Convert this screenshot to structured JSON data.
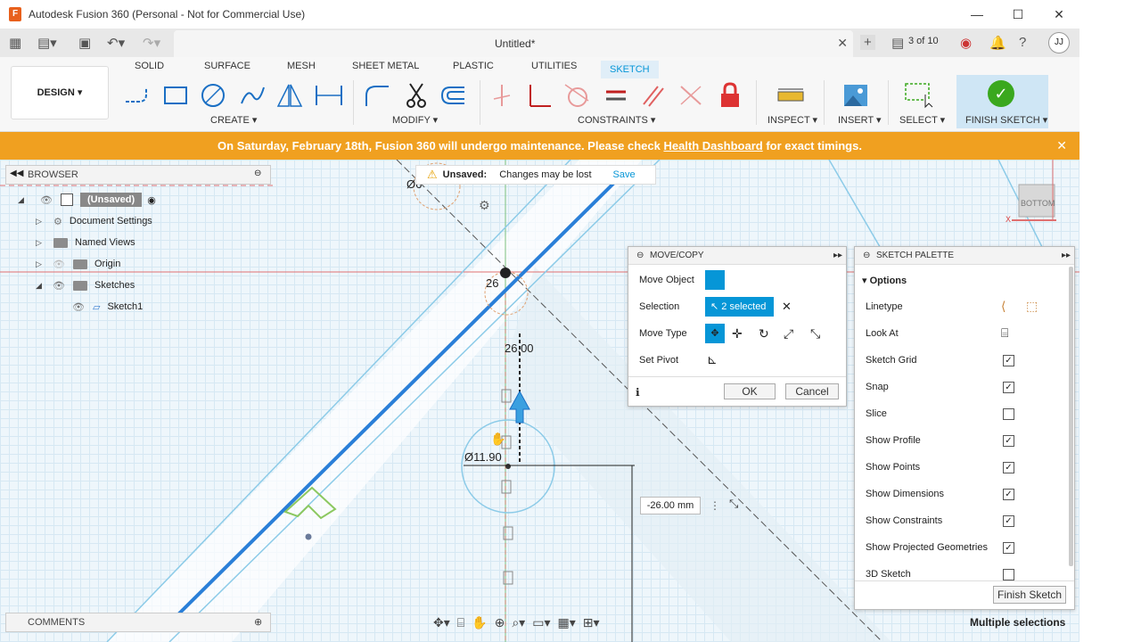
{
  "window": {
    "title": "Autodesk Fusion 360 (Personal - Not for Commercial Use)",
    "minimize": "—",
    "maximize": "☐",
    "close": "✕"
  },
  "tabbar": {
    "doc_title": "Untitled*",
    "count": "3 of 10",
    "user_initials": "JJ"
  },
  "ribbon": {
    "workspace": "DESIGN ▾",
    "tabs": [
      "SOLID",
      "SURFACE",
      "MESH",
      "SHEET METAL",
      "PLASTIC",
      "UTILITIES",
      "SKETCH"
    ],
    "groups": {
      "create": "CREATE ▾",
      "modify": "MODIFY ▾",
      "constraints": "CONSTRAINTS ▾",
      "inspect": "INSPECT ▾",
      "insert": "INSERT ▾",
      "select": "SELECT ▾",
      "finish": "FINISH SKETCH ▾"
    }
  },
  "banner": {
    "text_before": "On Saturday, February 18th, Fusion 360 will undergo maintenance. Please check ",
    "link": "Health Dashboard",
    "text_after": " for exact timings."
  },
  "browser": {
    "header": "BROWSER",
    "root": "(Unsaved)",
    "items": [
      "Document Settings",
      "Named Views",
      "Origin",
      "Sketches"
    ],
    "sketch": "Sketch1"
  },
  "unsaved": {
    "label": "Unsaved:",
    "message": "Changes may be lost",
    "save": "Save"
  },
  "movecopy": {
    "header": "MOVE/COPY",
    "move_object": "Move Object",
    "selection": "Selection",
    "selection_value": "2 selected",
    "move_type": "Move Type",
    "set_pivot": "Set Pivot",
    "ok": "OK",
    "cancel": "Cancel"
  },
  "palette": {
    "header": "SKETCH PALETTE",
    "section": "Options",
    "rows": [
      {
        "label": "Linetype"
      },
      {
        "label": "Look At"
      },
      {
        "label": "Sketch Grid",
        "checked": true
      },
      {
        "label": "Snap",
        "checked": true
      },
      {
        "label": "Slice",
        "checked": false
      },
      {
        "label": "Show Profile",
        "checked": true
      },
      {
        "label": "Show Points",
        "checked": true
      },
      {
        "label": "Show Dimensions",
        "checked": true
      },
      {
        "label": "Show Constraints",
        "checked": true
      },
      {
        "label": "Show Projected Geometries",
        "checked": true
      },
      {
        "label": "3D Sketch",
        "checked": false
      }
    ],
    "finish": "Finish Sketch"
  },
  "viewport": {
    "dim_distance": "26.00",
    "dim_diameter": "Ø11.90",
    "dim_diameter_top": "Ø6",
    "dim_mid": "26",
    "input_value": "-26.00 mm",
    "viewcube": "BOTTOM",
    "axis_x": "X"
  },
  "comments": {
    "header": "COMMENTS"
  },
  "status": {
    "selection": "Multiple selections"
  },
  "colors": {
    "accent": "#0696d7",
    "banner": "#f0a020",
    "finish": "#3aa81e"
  }
}
